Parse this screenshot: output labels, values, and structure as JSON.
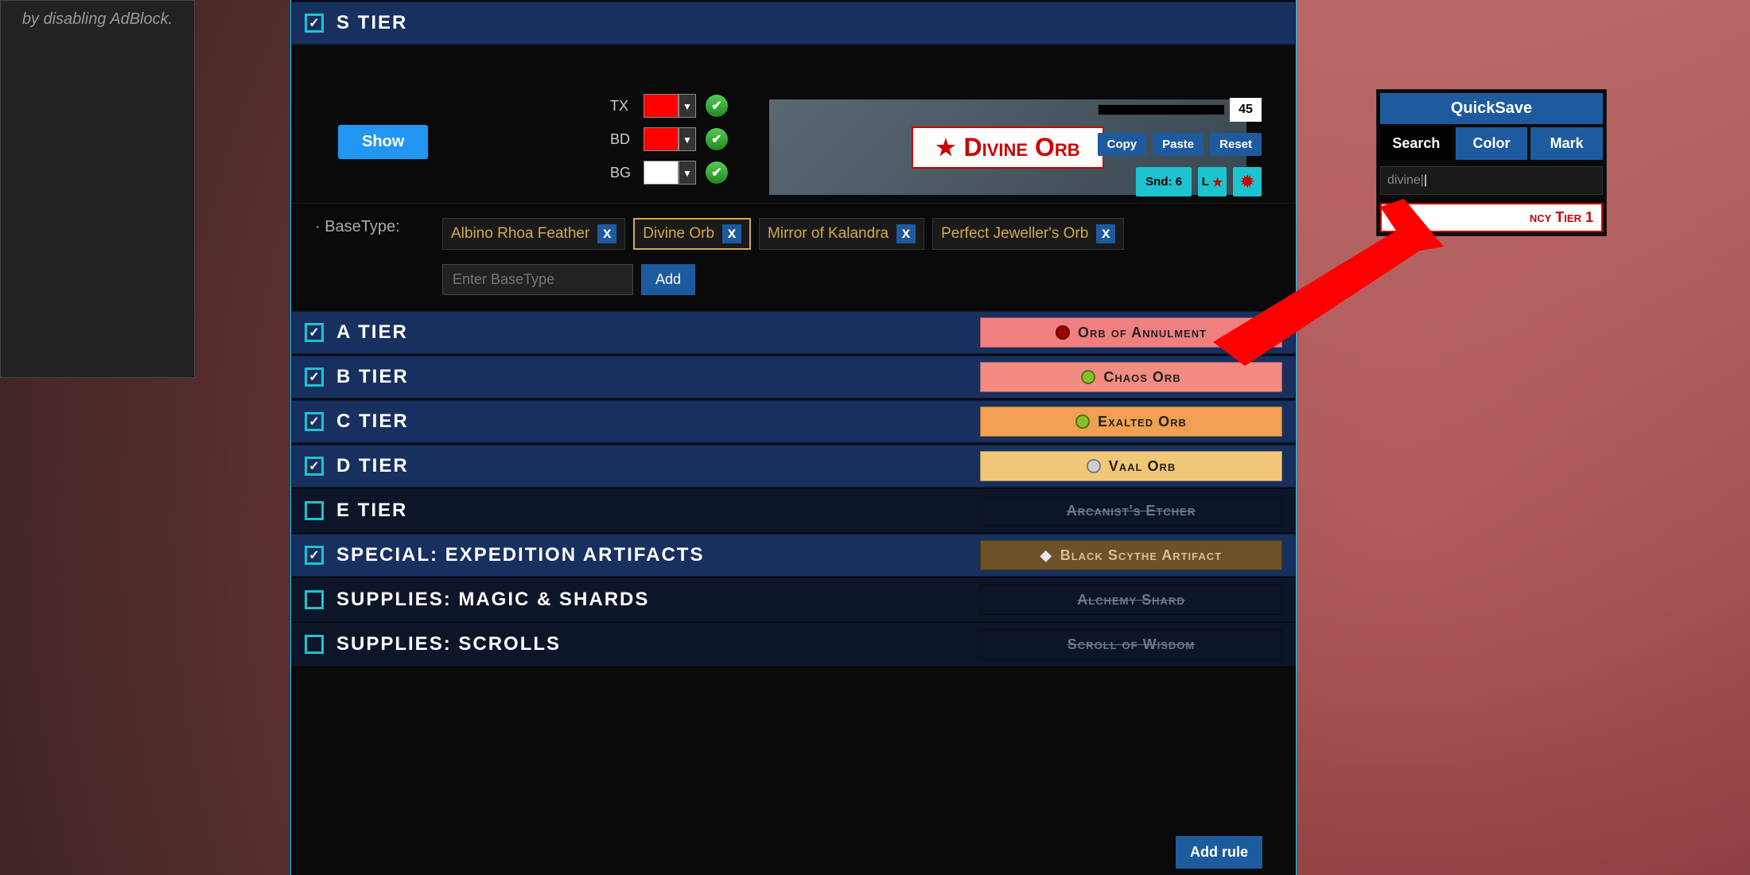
{
  "sidebar_note": "by disabling AdBlock.",
  "s_tier": {
    "label": "S TIER",
    "show_label": "Show",
    "color_rows": [
      {
        "label": "TX",
        "hex": "#ff0000"
      },
      {
        "label": "BD",
        "hex": "#ff0000"
      },
      {
        "label": "BG",
        "hex": "#ffffff"
      }
    ],
    "preview_text": "Divine Orb",
    "size_value": "45",
    "buttons": {
      "copy": "Copy",
      "paste": "Paste",
      "reset": "Reset",
      "sound": "Snd: 6",
      "l": "L"
    },
    "basetype_label": "· BaseType:",
    "basetypes": [
      {
        "name": "Albino Rhoa Feather",
        "hl": false
      },
      {
        "name": "Divine Orb",
        "hl": true
      },
      {
        "name": "Mirror of Kalandra",
        "hl": false
      },
      {
        "name": "Perfect Jeweller's Orb",
        "hl": false
      }
    ],
    "bt_placeholder": "Enter BaseType",
    "add_label": "Add"
  },
  "tiers": [
    {
      "checked": true,
      "dark": false,
      "label": "A TIER",
      "chip_bg": "#f08080",
      "chip_fg": "#222",
      "orb": "#a00000",
      "item": "Orb of Annulment",
      "strike": false
    },
    {
      "checked": true,
      "dark": false,
      "label": "B TIER",
      "chip_bg": "#f28b82",
      "chip_fg": "#222",
      "orb": "#8bbf2a",
      "item": "Chaos Orb",
      "strike": false
    },
    {
      "checked": true,
      "dark": false,
      "label": "C TIER",
      "chip_bg": "#f0a050",
      "chip_fg": "#222",
      "orb": "#8bbf2a",
      "item": "Exalted Orb",
      "strike": false
    },
    {
      "checked": true,
      "dark": false,
      "label": "D TIER",
      "chip_bg": "#f0c878",
      "chip_fg": "#222",
      "orb": "#d0d0d0",
      "item": "Vaal Orb",
      "strike": false
    },
    {
      "checked": false,
      "dark": true,
      "label": "E TIER",
      "chip_bg": "#0d1528",
      "chip_fg": "#6b7a8f",
      "orb": "",
      "item": "Arcanist's Etcher",
      "strike": true
    },
    {
      "checked": true,
      "dark": false,
      "label": "SPECIAL: EXPEDITION ARTIFACTS",
      "chip_bg": "#6b5228",
      "chip_fg": "#d4c090",
      "orb": "#e8e8e8",
      "item": "Black Scythe Artifact",
      "strike": false,
      "diamond": true
    },
    {
      "checked": false,
      "dark": true,
      "label": "SUPPLIES: MAGIC & SHARDS",
      "chip_bg": "#0d1528",
      "chip_fg": "#6b7a8f",
      "orb": "",
      "item": "Alchemy Shard",
      "strike": true
    },
    {
      "checked": false,
      "dark": true,
      "label": "SUPPLIES: SCROLLS",
      "chip_bg": "#0d1528",
      "chip_fg": "#6b7a8f",
      "orb": "",
      "item": "Scroll of Wisdom",
      "strike": true
    }
  ],
  "add_rule_label": "Add rule",
  "qs": {
    "title": "QuickSave",
    "tabs": {
      "search": "Search",
      "color": "Color",
      "mark": "Mark"
    },
    "input": "divine|",
    "result": "ncy Tier 1"
  }
}
